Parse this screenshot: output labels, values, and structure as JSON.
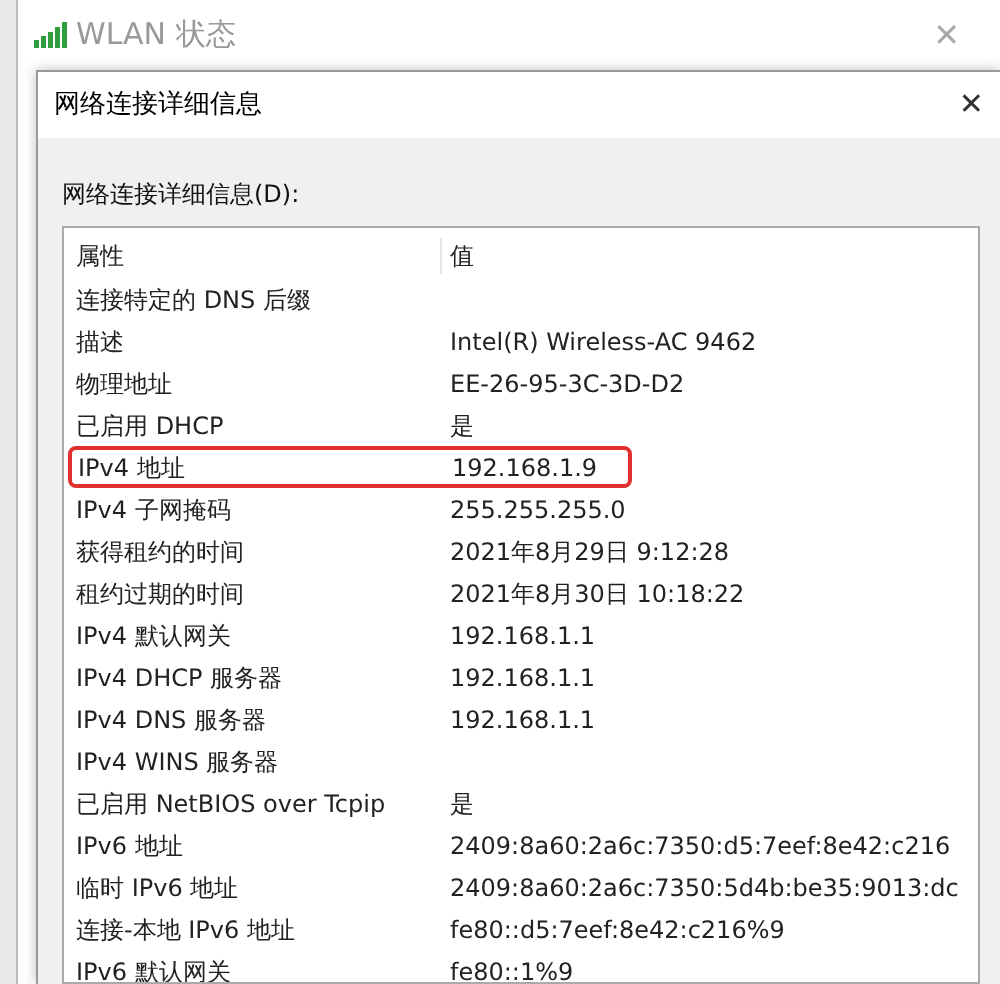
{
  "outer_window": {
    "title": "WLAN 状态",
    "close": "✕"
  },
  "dialog": {
    "title": "网络连接详细信息",
    "close": "✕",
    "list_label": "网络连接详细信息(D):",
    "columns": [
      "属性",
      "值"
    ],
    "rows": [
      {
        "property": "连接特定的 DNS 后缀",
        "value": "",
        "highlighted": false
      },
      {
        "property": "描述",
        "value": "Intel(R) Wireless-AC 9462",
        "highlighted": false
      },
      {
        "property": "物理地址",
        "value": "EE-26-95-3C-3D-D2",
        "highlighted": false
      },
      {
        "property": "已启用 DHCP",
        "value": "是",
        "highlighted": false
      },
      {
        "property": "IPv4 地址",
        "value": "192.168.1.9",
        "highlighted": true
      },
      {
        "property": "IPv4 子网掩码",
        "value": "255.255.255.0",
        "highlighted": false
      },
      {
        "property": "获得租约的时间",
        "value": "2021年8月29日 9:12:28",
        "highlighted": false
      },
      {
        "property": "租约过期的时间",
        "value": "2021年8月30日 10:18:22",
        "highlighted": false
      },
      {
        "property": "IPv4 默认网关",
        "value": "192.168.1.1",
        "highlighted": false
      },
      {
        "property": "IPv4 DHCP 服务器",
        "value": "192.168.1.1",
        "highlighted": false
      },
      {
        "property": "IPv4 DNS 服务器",
        "value": "192.168.1.1",
        "highlighted": false
      },
      {
        "property": "IPv4 WINS 服务器",
        "value": "",
        "highlighted": false
      },
      {
        "property": "已启用 NetBIOS over Tcpip",
        "value": "是",
        "highlighted": false
      },
      {
        "property": "IPv6 地址",
        "value": "2409:8a60:2a6c:7350:d5:7eef:8e42:c216",
        "highlighted": false
      },
      {
        "property": "临时 IPv6 地址",
        "value": "2409:8a60:2a6c:7350:5d4b:be35:9013:dc",
        "highlighted": false
      },
      {
        "property": "连接-本地 IPv6 地址",
        "value": "fe80::d5:7eef:8e42:c216%9",
        "highlighted": false
      },
      {
        "property": "IPv6 默认网关",
        "value": "fe80::1%9",
        "highlighted": false
      }
    ]
  }
}
